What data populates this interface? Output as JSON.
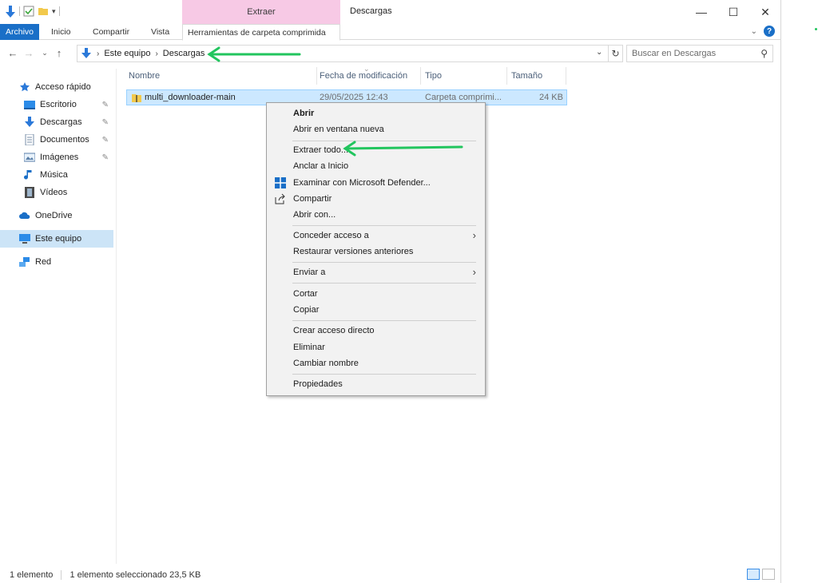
{
  "window": {
    "title": "Descargas",
    "context_tab_header": "Extraer",
    "controls": {
      "minimize": "—",
      "maximize": "☐",
      "close": "✕"
    }
  },
  "ribbon": {
    "tabs": [
      {
        "label": "Archivo"
      },
      {
        "label": "Inicio"
      },
      {
        "label": "Compartir"
      },
      {
        "label": "Vista"
      },
      {
        "label": "Herramientas de carpeta comprimida"
      }
    ],
    "help_label": "?"
  },
  "address_bar": {
    "breadcrumb": [
      "Este equipo",
      "Descargas"
    ],
    "search_placeholder": "Buscar en Descargas"
  },
  "nav_pane": {
    "items": [
      {
        "label": "Acceso rápido",
        "icon": "star-icon"
      },
      {
        "label": "Escritorio",
        "icon": "desktop-icon",
        "pinned": true
      },
      {
        "label": "Descargas",
        "icon": "download-arrow-icon",
        "pinned": true
      },
      {
        "label": "Documentos",
        "icon": "document-icon",
        "pinned": true
      },
      {
        "label": "Imágenes",
        "icon": "pictures-icon",
        "pinned": true
      },
      {
        "label": "Música",
        "icon": "music-note-icon"
      },
      {
        "label": "Vídeos",
        "icon": "video-icon"
      },
      {
        "label": "OneDrive",
        "icon": "cloud-icon"
      },
      {
        "label": "Este equipo",
        "icon": "computer-icon",
        "selected": true
      },
      {
        "label": "Red",
        "icon": "network-icon"
      }
    ]
  },
  "file_list": {
    "columns": [
      "Nombre",
      "Fecha de modificación",
      "Tipo",
      "Tamaño"
    ],
    "rows": [
      {
        "name": "multi_downloader-main",
        "date": "29/05/2025 12:43",
        "type": "Carpeta comprimi...",
        "size": "24 KB",
        "selected": true
      }
    ]
  },
  "context_menu": {
    "items": [
      {
        "label": "Abrir",
        "bold": true
      },
      {
        "label": "Abrir en ventana nueva"
      },
      {
        "label": "Extraer todo..."
      },
      {
        "label": "Anclar a Inicio"
      },
      {
        "label": "Examinar con Microsoft Defender...",
        "icon": "defender-shield-icon"
      },
      {
        "label": "Compartir",
        "icon": "share-icon"
      },
      {
        "label": "Abrir con..."
      },
      {
        "label": "Conceder acceso a",
        "submenu": true
      },
      {
        "label": "Restaurar versiones anteriores"
      },
      {
        "label": "Enviar a",
        "submenu": true
      },
      {
        "label": "Cortar"
      },
      {
        "label": "Copiar"
      },
      {
        "label": "Crear acceso directo"
      },
      {
        "label": "Eliminar"
      },
      {
        "label": "Cambiar nombre"
      },
      {
        "label": "Propiedades"
      }
    ]
  },
  "status_bar": {
    "item_count": "1 elemento",
    "selection": "1 elemento seleccionado  23,5 KB"
  },
  "colors": {
    "accent_blue": "#1a6fc7",
    "context_tab_pink": "#f7c9e5",
    "selection_blue": "#cce8ff",
    "annotation_green": "#22c55e"
  }
}
